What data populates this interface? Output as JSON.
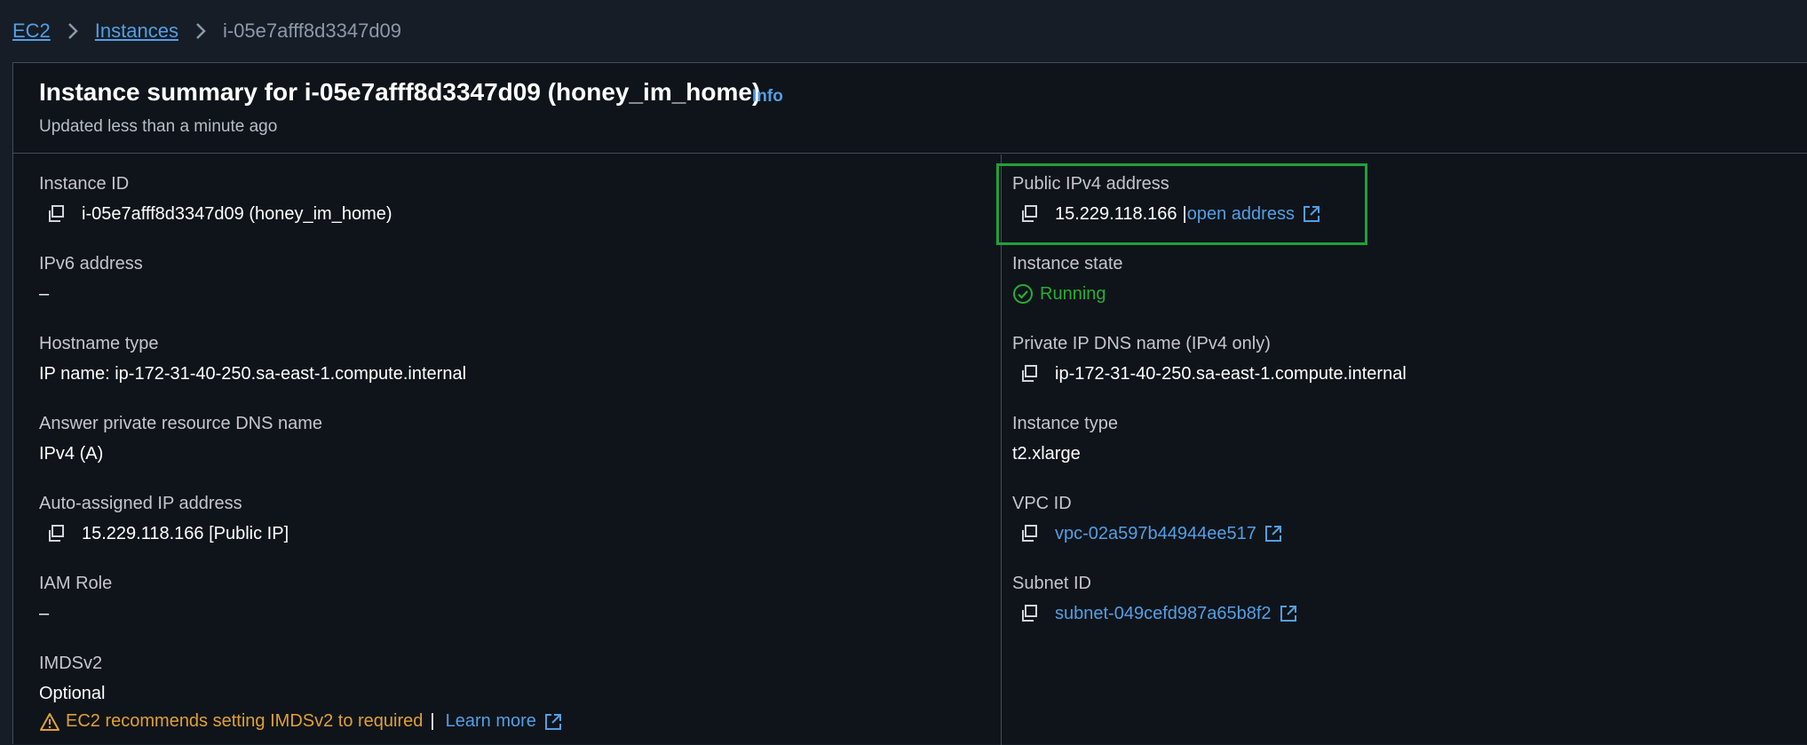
{
  "breadcrumb": {
    "items": [
      "EC2",
      "Instances"
    ],
    "current": "i-05e7afff8d3347d09"
  },
  "header": {
    "title": "Instance summary for i-05e7afff8d3347d09 (honey_im_home)",
    "info": "Info",
    "updated": "Updated less than a minute ago"
  },
  "left": {
    "instance_id": {
      "label": "Instance ID",
      "value": "i-05e7afff8d3347d09 (honey_im_home)"
    },
    "ipv6": {
      "label": "IPv6 address",
      "value": "–"
    },
    "hostname": {
      "label": "Hostname type",
      "value": "IP name: ip-172-31-40-250.sa-east-1.compute.internal"
    },
    "answer_dns": {
      "label": "Answer private resource DNS name",
      "value": "IPv4 (A)"
    },
    "auto_ip": {
      "label": "Auto-assigned IP address",
      "value": "15.229.118.166 [Public IP]"
    },
    "iam_role": {
      "label": "IAM Role",
      "value": "–"
    },
    "imdsv2": {
      "label": "IMDSv2",
      "value": "Optional",
      "warning": "EC2 recommends setting IMDSv2 to required",
      "pipe": "|",
      "learn_more": "Learn more"
    }
  },
  "right": {
    "public_ipv4": {
      "label": "Public IPv4 address",
      "value": "15.229.118.166",
      "sep": "|",
      "link": "open address"
    },
    "state": {
      "label": "Instance state",
      "value": "Running"
    },
    "private_dns": {
      "label": "Private IP DNS name (IPv4 only)",
      "value": "ip-172-31-40-250.sa-east-1.compute.internal"
    },
    "type": {
      "label": "Instance type",
      "value": "t2.xlarge"
    },
    "vpc": {
      "label": "VPC ID",
      "value": "vpc-02a597b44944ee517"
    },
    "subnet": {
      "label": "Subnet ID",
      "value": "subnet-049cefd987a65b8f2"
    }
  },
  "colors": {
    "link": "#539fe5",
    "success": "#29ad32",
    "warning": "#e0a035",
    "highlight": "#1fa13a"
  }
}
